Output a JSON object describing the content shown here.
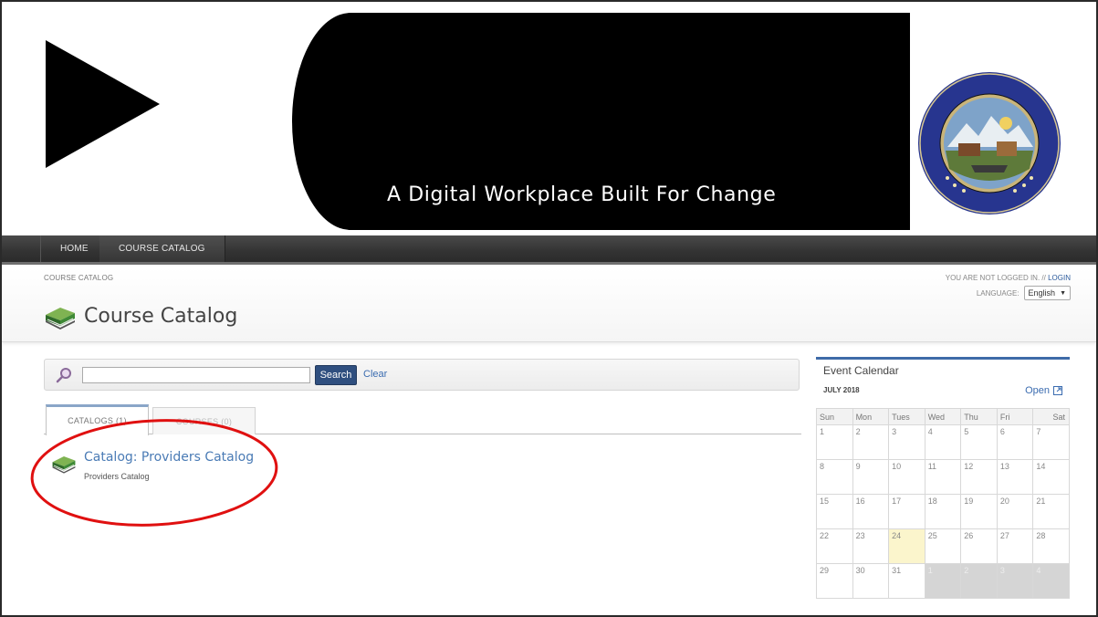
{
  "banner": {
    "tagline": "A Digital Workplace Built For Change",
    "seal_text": "THE GREAT SEAL OF THE STATE OF NEVADA",
    "seal_motto": "ALL FOR OUR COUNTRY"
  },
  "nav": {
    "items": [
      {
        "label": "HOME"
      },
      {
        "label": "COURSE CATALOG"
      }
    ]
  },
  "header": {
    "breadcrumb": "COURSE CATALOG",
    "login_status": "YOU ARE NOT LOGGED IN. //",
    "login_link": "LOGIN",
    "language_label": "LANGUAGE:",
    "language_value": "English",
    "page_title": "Course Catalog"
  },
  "search": {
    "placeholder": "",
    "value": "",
    "search_button": "Search",
    "clear_link": "Clear"
  },
  "tabs": [
    {
      "label": "CATALOGS (1)",
      "active": true
    },
    {
      "label": "COURSES (0)",
      "active": false
    }
  ],
  "catalog_list": [
    {
      "title": "Catalog: Providers Catalog",
      "description": "Providers Catalog"
    }
  ],
  "calendar": {
    "title": "Event Calendar",
    "month": "JULY 2018",
    "open_link": "Open",
    "weekdays": [
      "Sun",
      "Mon",
      "Tues",
      "Wed",
      "Thu",
      "Fri",
      "Sat"
    ],
    "weeks": [
      [
        "1",
        "2",
        "3",
        "4",
        "5",
        "6",
        "7"
      ],
      [
        "8",
        "9",
        "10",
        "11",
        "12",
        "13",
        "14"
      ],
      [
        "15",
        "16",
        "17",
        "18",
        "19",
        "20",
        "21"
      ],
      [
        "22",
        "23",
        "24",
        "25",
        "26",
        "27",
        "28"
      ],
      [
        "29",
        "30",
        "31",
        "1",
        "2",
        "3",
        "4"
      ]
    ],
    "today": "24"
  },
  "colors": {
    "accent_blue": "#3e6ba8",
    "search_button": "#2f4f7f",
    "link": "#3b6cb0",
    "highlight_ellipse": "#e01010",
    "today_cell": "#fbf5cc"
  }
}
